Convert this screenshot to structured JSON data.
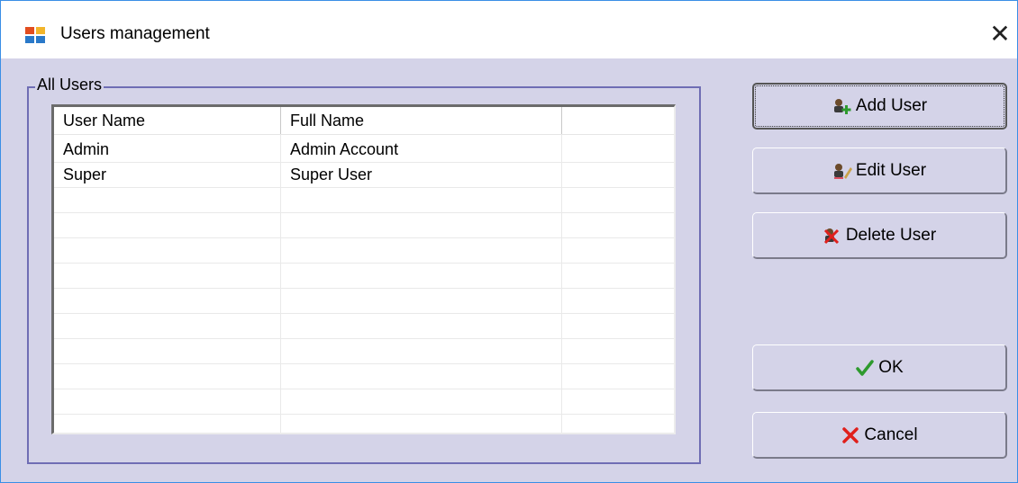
{
  "window": {
    "title": "Users management",
    "close_label": "✕"
  },
  "group": {
    "label": "All Users"
  },
  "table": {
    "columns": [
      "User Name",
      "Full Name",
      ""
    ],
    "rows": [
      {
        "user_name": "Admin",
        "full_name": "Admin Account"
      },
      {
        "user_name": "Super",
        "full_name": "Super User"
      }
    ]
  },
  "buttons": {
    "add_user": "Add User",
    "edit_user": "Edit User",
    "delete_user": "Delete User",
    "ok": "OK",
    "cancel": "Cancel"
  },
  "icons": {
    "app": "window-app-icon",
    "add": "add-user-icon",
    "edit": "edit-user-icon",
    "delete": "delete-user-icon",
    "ok": "checkmark-icon",
    "cancel": "x-mark-icon"
  },
  "colors": {
    "client_bg": "#d4d3e8",
    "group_border": "#6f6db4",
    "ok_check": "#2e9a2e",
    "cancel_x": "#e0201c"
  }
}
